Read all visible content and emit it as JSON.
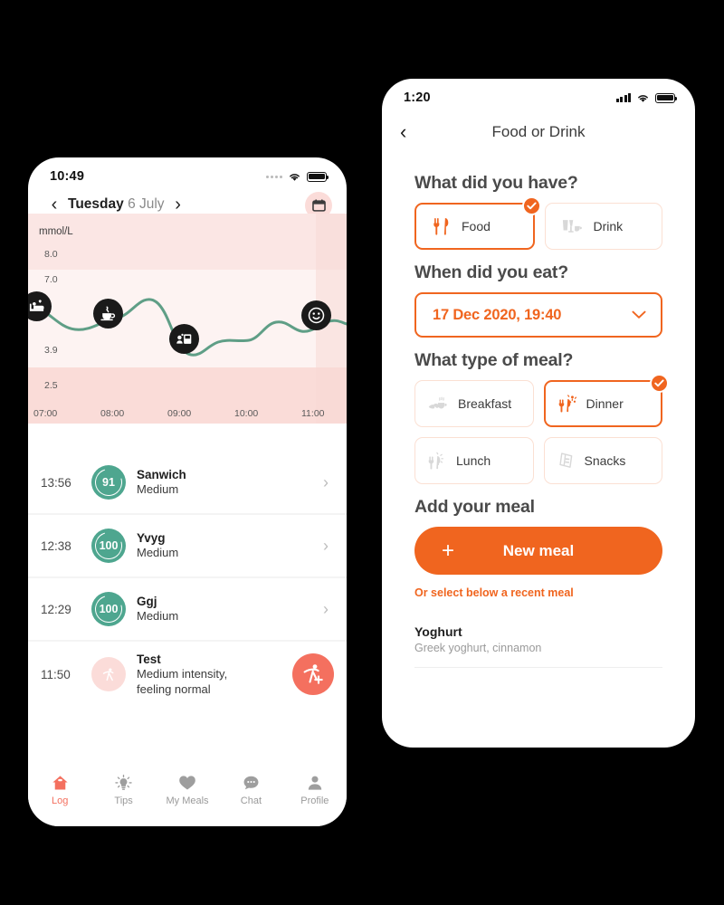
{
  "left_phone": {
    "status": {
      "time": "10:49",
      "signal_icon": "signal-dots-icon",
      "wifi_icon": "wifi-icon",
      "battery_icon": "battery-icon"
    },
    "date_nav": {
      "prev_icon": "chevron-left-icon",
      "next_icon": "chevron-right-icon",
      "weekday": "Tuesday",
      "date": "6 July",
      "calendar_icon": "calendar-icon",
      "info_icon": "info-icon"
    },
    "chart_data": {
      "type": "line",
      "title": "",
      "unit_label": "mmol/L",
      "ylabel": "mmol/L",
      "xlabel": "",
      "ytick_labels": [
        "8.0",
        "7.0",
        "3.9",
        "2.5"
      ],
      "ytick_values": [
        8.0,
        7.0,
        3.9,
        2.5
      ],
      "xtick_labels": [
        "07:00",
        "08:00",
        "09:00",
        "10:00",
        "11:00"
      ],
      "ylim": [
        2.0,
        8.6
      ],
      "xlim": [
        "06:45",
        "11:20"
      ],
      "grid": false,
      "series": [
        {
          "name": "Glucose",
          "color": "#5f9e86",
          "x": [
            "06:50",
            "07:05",
            "07:20",
            "07:35",
            "07:50",
            "08:00",
            "08:12",
            "08:25",
            "08:40",
            "08:52",
            "09:05",
            "09:20",
            "09:40",
            "10:00",
            "10:15",
            "10:30",
            "10:45",
            "11:00",
            "11:15"
          ],
          "values": [
            6.6,
            6.3,
            5.8,
            5.7,
            5.9,
            6.2,
            6.9,
            6.6,
            5.6,
            4.6,
            4.9,
            5.3,
            5.1,
            5.0,
            5.3,
            6.0,
            5.7,
            5.6,
            6.0
          ]
        }
      ],
      "bands": [
        {
          "name": "above-range",
          "from": 7.0,
          "to": 8.6,
          "color": "#fbe6e4"
        },
        {
          "name": "in-range",
          "from": 3.9,
          "to": 7.0,
          "color": "#fdf3f2"
        },
        {
          "name": "below-range",
          "from": 2.0,
          "to": 3.9,
          "color": "#fadcd8"
        }
      ],
      "markers": [
        {
          "icon": "sleep-icon",
          "time": "06:52",
          "value": 6.6
        },
        {
          "icon": "coffee-icon",
          "time": "07:55",
          "value": 6.1
        },
        {
          "icon": "breakfast-box-icon",
          "time": "08:55",
          "value": 5.0
        },
        {
          "icon": "smiley-icon",
          "time": "11:02",
          "value": 6.0
        }
      ]
    },
    "log_rows": [
      {
        "time": "13:56",
        "badge": "91",
        "badge_kind": "green",
        "title": "Sanwich",
        "subtitle": "Medium",
        "arrow_icon": "chevron-right-icon"
      },
      {
        "time": "12:38",
        "badge": "100",
        "badge_kind": "green",
        "title": "Yvyg",
        "subtitle": "Medium",
        "arrow_icon": "chevron-right-icon"
      },
      {
        "time": "12:29",
        "badge": "100",
        "badge_kind": "green",
        "title": "Ggj",
        "subtitle": "Medium",
        "arrow_icon": "chevron-right-icon"
      },
      {
        "time": "11:50",
        "badge": "",
        "badge_kind": "pink",
        "badge_icon": "activity-icon",
        "title": "Test",
        "subtitle": "Medium intensity,\nfeeling normal",
        "fab_icon": "add-activity-icon"
      }
    ],
    "tabs": [
      {
        "label": "Log",
        "icon": "home-icon",
        "active": true
      },
      {
        "label": "Tips",
        "icon": "bulb-icon",
        "active": false
      },
      {
        "label": "My Meals",
        "icon": "heart-icon",
        "active": false
      },
      {
        "label": "Chat",
        "icon": "chat-icon",
        "active": false
      },
      {
        "label": "Profile",
        "icon": "person-icon",
        "active": false
      }
    ]
  },
  "right_phone": {
    "status": {
      "time": "1:20",
      "signal_icon": "signal-bars-icon",
      "wifi_icon": "wifi-icon",
      "battery_icon": "battery-icon"
    },
    "header": {
      "back_icon": "chevron-left-icon",
      "title": "Food or Drink"
    },
    "q1": {
      "heading": "What did you have?",
      "options": [
        {
          "label": "Food",
          "icon": "cutlery-icon",
          "selected": true,
          "tick_icon": "check-icon"
        },
        {
          "label": "Drink",
          "icon": "glasses-icon",
          "selected": false
        }
      ]
    },
    "q2": {
      "heading": "When did you eat?",
      "value": "17 Dec 2020, 19:40",
      "chevron_icon": "chevron-down-icon"
    },
    "q3": {
      "heading": "What type of meal?",
      "options": [
        {
          "label": "Breakfast",
          "icon": "croissant-coffee-icon",
          "selected": false
        },
        {
          "label": "Dinner",
          "icon": "dinner-icon",
          "selected": true,
          "tick_icon": "check-icon"
        },
        {
          "label": "Lunch",
          "icon": "lunch-icon",
          "selected": false
        },
        {
          "label": "Snacks",
          "icon": "chocolate-bar-icon",
          "selected": false
        }
      ]
    },
    "q4": {
      "heading": "Add your meal",
      "new_meal_label": "New meal",
      "plus_icon": "plus-icon",
      "or_text": "Or select below a recent meal"
    },
    "recent_meals": [
      {
        "title": "Yoghurt",
        "subtitle": "Greek yoghurt, cinnamon"
      }
    ]
  },
  "colors": {
    "orange": "#f0651f",
    "coral": "#f4705f",
    "teal": "#4ea68f",
    "line_green": "#5f9e86",
    "band_high": "#fbe6e4",
    "band_mid": "#fdf3f2",
    "band_low": "#fadcd8",
    "pink_soft": "#fbdcd9",
    "text_dark": "#1f1f1f",
    "text_muted": "#9a9a9a"
  }
}
